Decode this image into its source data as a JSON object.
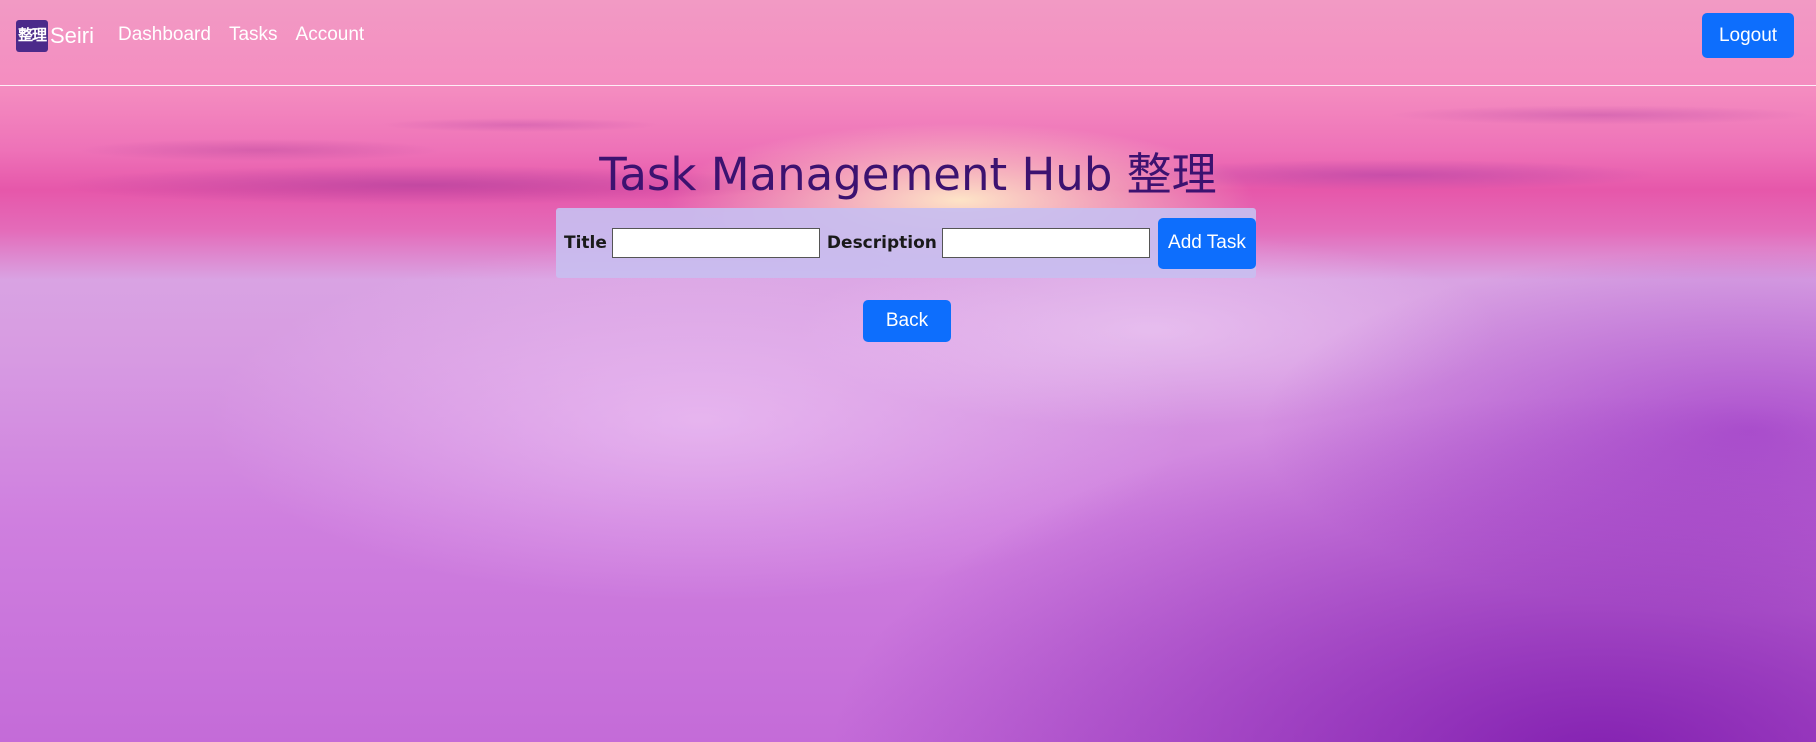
{
  "navbar": {
    "brand": {
      "logo_text": "整理",
      "name": "Seiri"
    },
    "links": [
      {
        "label": "Dashboard"
      },
      {
        "label": "Tasks"
      },
      {
        "label": "Account"
      }
    ],
    "logout_label": "Logout"
  },
  "main": {
    "title": "Task Management Hub 整理",
    "form": {
      "title_label": "Title",
      "title_value": "",
      "description_label": "Description",
      "description_value": "",
      "submit_label": "Add Task"
    },
    "back_label": "Back"
  },
  "colors": {
    "primary_button": "#0d6efd",
    "title_text": "#3c1270",
    "form_background": "#c8bef0"
  }
}
